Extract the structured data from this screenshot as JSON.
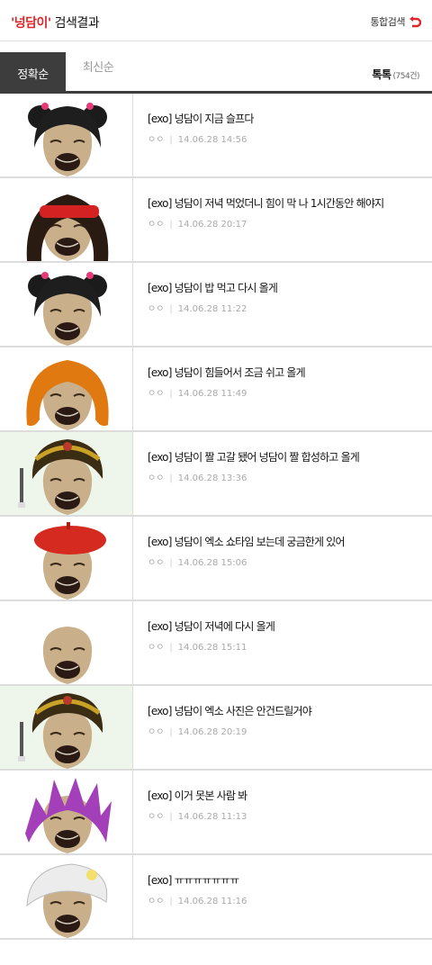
{
  "header": {
    "keyword": "'넝담이'",
    "suffix": " 검색결과",
    "integrated_search": "통합검색",
    "accent": "#e0262b"
  },
  "tabs": {
    "accurate": "정확순",
    "latest": "최신순",
    "toktok_label": "톡톡",
    "toktok_count": "(754건)"
  },
  "items": [
    {
      "title": "[exo] 넝담이 지금 슬프다",
      "author": "ㅇㅇ",
      "date": "14.06.28 14:56",
      "hair": "black-buns"
    },
    {
      "title": "[exo] 넝담이 저녁 먹었더니 힘이 막 나 1시간동안 해야지",
      "author": "ㅇㅇ",
      "date": "14.06.28 20:17",
      "hair": "long-red-band"
    },
    {
      "title": "[exo] 넝담이 밥 먹고 다시 올게",
      "author": "ㅇㅇ",
      "date": "14.06.28 11:22",
      "hair": "black-buns"
    },
    {
      "title": "[exo] 넝담이 힘들어서 조금 쉬고 올게",
      "author": "ㅇㅇ",
      "date": "14.06.28 11:49",
      "hair": "orange-curls"
    },
    {
      "title": "[exo] 넝담이 짤 고갈 됐어 넝담이 짤 합성하고 올게",
      "author": "ㅇㅇ",
      "date": "14.06.28 13:36",
      "hair": "crown"
    },
    {
      "title": "[exo] 넝담이 엑소 쇼타임 보는데 궁금한게 있어",
      "author": "ㅇㅇ",
      "date": "14.06.28 15:06",
      "hair": "red-beret"
    },
    {
      "title": "[exo] 넝담이 저녁에 다시 올게",
      "author": "ㅇㅇ",
      "date": "14.06.28 15:11",
      "hair": "bald"
    },
    {
      "title": "[exo] 넝담이 엑소 사진은 안건드릴거야",
      "author": "ㅇㅇ",
      "date": "14.06.28 20:19",
      "hair": "crown"
    },
    {
      "title": "[exo] 이거 못본 사람 봐",
      "author": "ㅇㅇ",
      "date": "14.06.28 11:13",
      "hair": "purple-spiky"
    },
    {
      "title": "[exo] ㅠㅠㅠㅠㅠㅠㅠ",
      "author": "ㅇㅇ",
      "date": "14.06.28 11:16",
      "hair": "white-hat"
    }
  ]
}
